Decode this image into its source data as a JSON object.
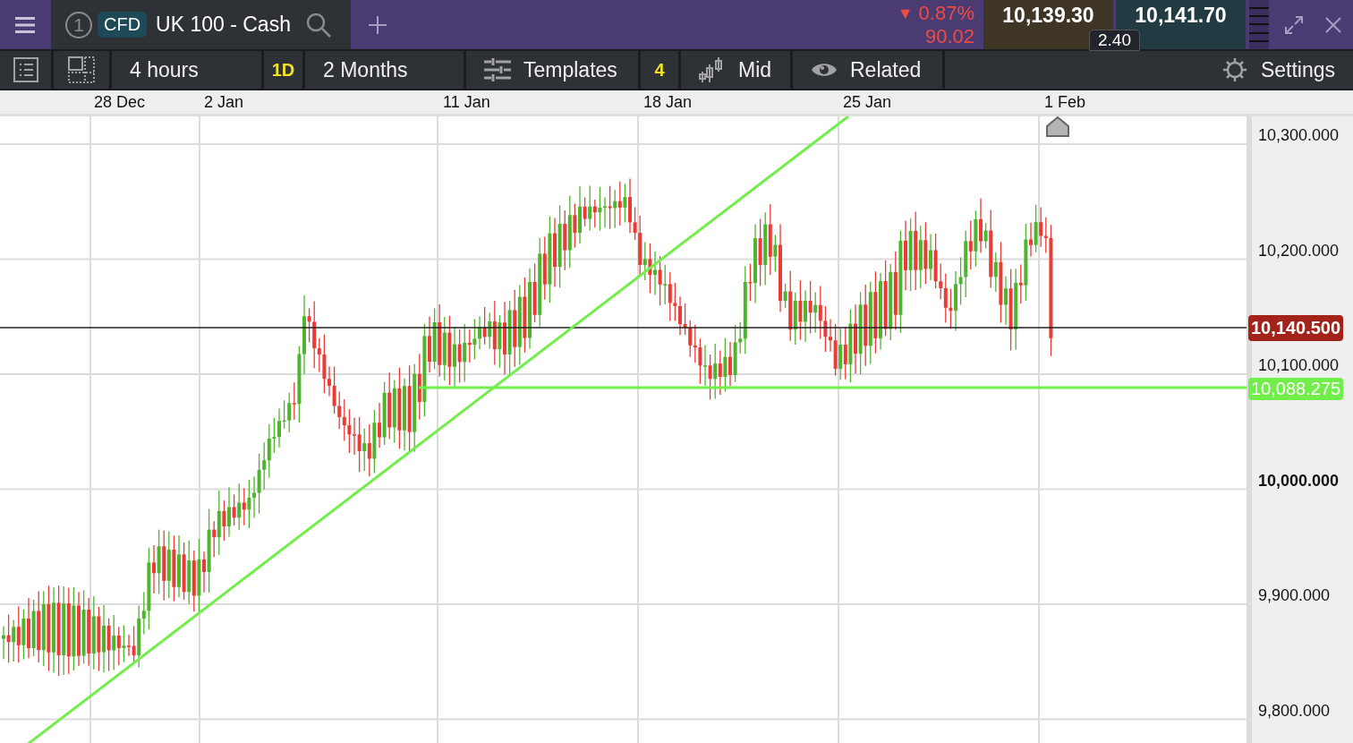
{
  "top_bar": {
    "tab": {
      "number": "1",
      "badge": "CFD",
      "title": "UK 100 - Cash"
    },
    "change": {
      "arrow": "▼",
      "percent": "0.87%",
      "points": "90.02"
    },
    "sell_price": "10,139.30",
    "buy_price": "10,141.70",
    "spread": "2.40"
  },
  "toolbar": {
    "interval": "4 hours",
    "quick_range": "1D",
    "range": "2 Months",
    "templates": "Templates",
    "templates_count": "4",
    "price_type": "Mid",
    "related": "Related",
    "settings": "Settings"
  },
  "chart": {
    "dates": [
      "28 Dec",
      "2 Jan",
      "11 Jan",
      "18 Jan",
      "25 Jan",
      "1 Feb"
    ],
    "price_ticks": [
      {
        "label": "10,300.000",
        "bold": false
      },
      {
        "label": "10,200.000",
        "bold": false
      },
      {
        "label": "10,100.000",
        "bold": false
      },
      {
        "label": "10,000.000",
        "bold": true
      },
      {
        "label": "9,900.000",
        "bold": false
      },
      {
        "label": "9,800.000",
        "bold": false
      }
    ],
    "current_price": "10,140.500",
    "line_price": "10,088.275"
  }
}
